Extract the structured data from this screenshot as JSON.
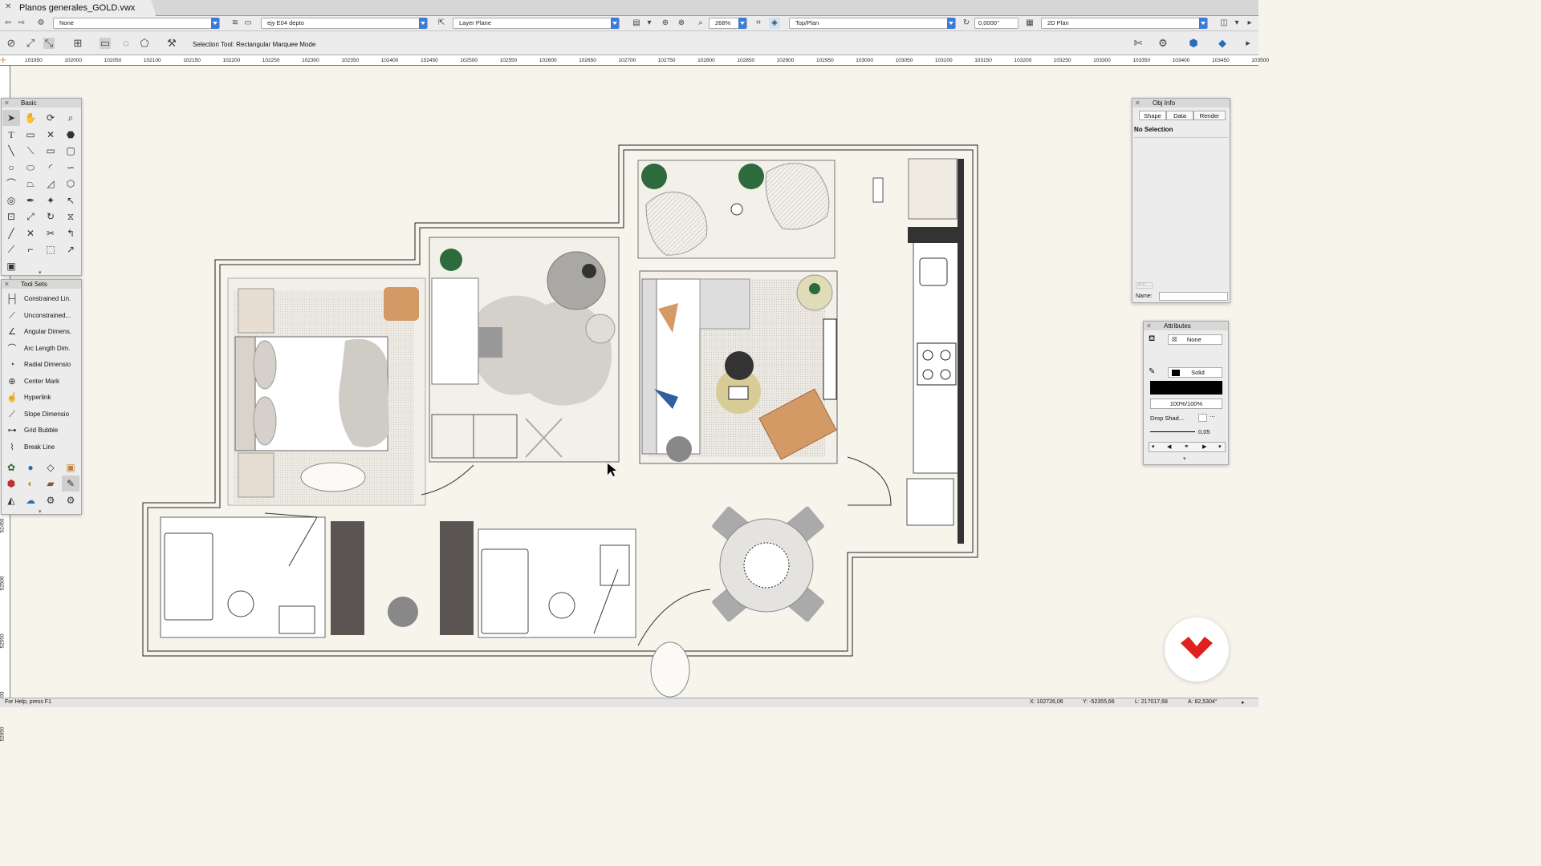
{
  "window": {
    "title": "Planos generales_GOLD.vwx"
  },
  "viewbar": {
    "class_value": "None",
    "layer_value": "ejy E04 depto",
    "plane_value": "Layer Plane",
    "zoom_value": "268%",
    "view_value": "Top/Plan",
    "rotation_value": "0,0000°",
    "render_value": "2D Plan"
  },
  "toolbar": {
    "mode_label": "Selection Tool: Rectangular Marquee Mode"
  },
  "rulers": {
    "horizontal": [
      "101950",
      "102000",
      "102050",
      "102100",
      "102150",
      "102200",
      "102250",
      "102300",
      "102350",
      "102400",
      "102450",
      "102500",
      "102550",
      "102600",
      "102650",
      "102700",
      "102750",
      "102800",
      "102850",
      "102900",
      "102950",
      "103000",
      "103050",
      "103100",
      "103150",
      "103200",
      "103250",
      "103300",
      "103350",
      "103400",
      "103450",
      "103500"
    ],
    "vertical": [
      "51",
      "52450",
      "52500",
      "52550",
      "52600",
      "52650"
    ]
  },
  "basic_palette": {
    "title": "Basic"
  },
  "toolsets_palette": {
    "title": "Tool Sets",
    "items": [
      "Constrained Lin.",
      "Unconstrained...",
      "Angular Dimens.",
      "Arc Length Dim.",
      "Radial Dimensio",
      "Center Mark",
      "Hyperlink",
      "Slope Dimensio",
      "Grid Bubble",
      "Break Line"
    ]
  },
  "objinfo": {
    "title": "Obj Info",
    "tabs": [
      "Shape",
      "Data",
      "Render"
    ],
    "selection": "No Selection",
    "ifc_label": "IFC...",
    "name_label": "Name:"
  },
  "attributes": {
    "title": "Attributes",
    "fill_value": "None",
    "pen_value": "Solid",
    "opacity": "100%/100%",
    "drop_shadow": "Drop Shad...",
    "line_weight": "0,05",
    "dots": "..."
  },
  "status": {
    "help": "For Help, press F1",
    "x": "X: 102726,06",
    "y": "Y: -52355,66",
    "l": "L: 217017,68",
    "a": "A: 82,5304°"
  },
  "colors": {
    "accent": "#3c7cd6",
    "brand": "#e0201c",
    "canvas": "#f7f4ec"
  }
}
